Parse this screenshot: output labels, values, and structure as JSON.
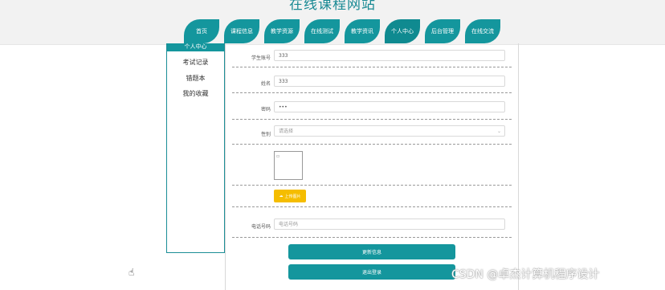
{
  "site": {
    "title": "在线课程网站"
  },
  "nav": {
    "items": [
      {
        "label": "首页"
      },
      {
        "label": "课程信息"
      },
      {
        "label": "教学资源"
      },
      {
        "label": "在线测试"
      },
      {
        "label": "教学资讯"
      },
      {
        "label": "个人中心"
      },
      {
        "label": "后台管理"
      },
      {
        "label": "在线交流"
      }
    ],
    "active": "个人中心"
  },
  "sidebar": {
    "header": "个人中心",
    "items": [
      {
        "label": "考试记录"
      },
      {
        "label": "错题本"
      },
      {
        "label": "我的收藏"
      }
    ]
  },
  "form": {
    "student_id": {
      "label": "学生账号",
      "value": "333"
    },
    "name": {
      "label": "姓名",
      "value": "333"
    },
    "password": {
      "label": "密码",
      "value": "•••"
    },
    "gender": {
      "label": "性别",
      "value": "请选择"
    },
    "upload_label": "上传图片",
    "phone": {
      "label": "电话号码",
      "placeholder": "电话号码"
    },
    "update_button": "更新信息",
    "logout_button": "退出登录"
  },
  "watermark": "CSDN @卓杰计算机程序设计"
}
